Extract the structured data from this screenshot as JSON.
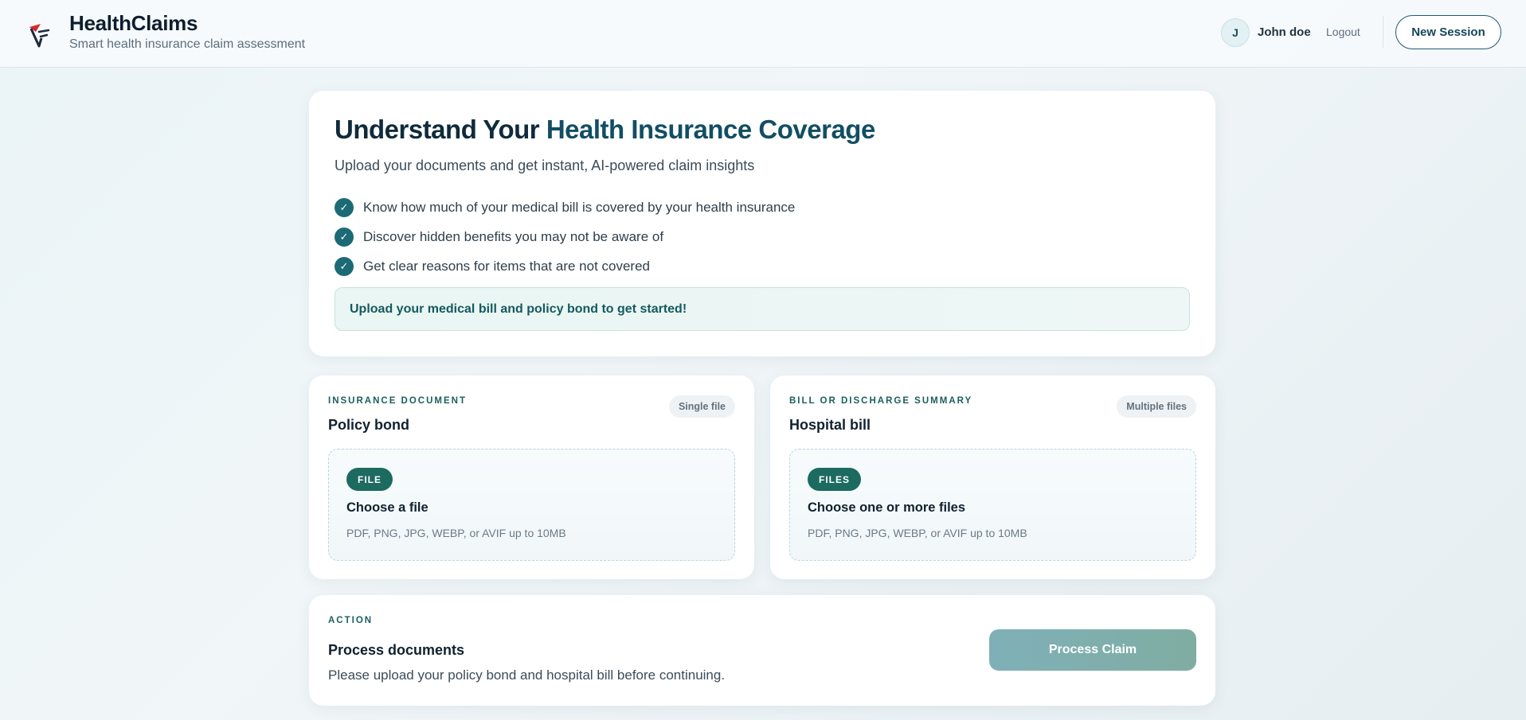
{
  "header": {
    "brand_title": "HealthClaims",
    "brand_subtitle": "Smart health insurance claim assessment",
    "avatar_initial": "J",
    "user_name": "John doe",
    "logout_label": "Logout",
    "new_session_label": "New Session"
  },
  "hero": {
    "title_part1": "Understand Your ",
    "title_part2": "Health Insurance Coverage",
    "subtitle": "Upload your documents and get instant, AI-powered claim insights",
    "bullets": [
      "Know how much of your medical bill is covered by your health insurance",
      "Discover hidden benefits you may not be aware of",
      "Get clear reasons for items that are not covered"
    ],
    "callout": "Upload your medical bill and policy bond to get started!"
  },
  "uploads": [
    {
      "eyebrow": "INSURANCE DOCUMENT",
      "badge": "Single file",
      "title": "Policy bond",
      "pill": "FILE",
      "prompt": "Choose a file",
      "hint": "PDF, PNG, JPG, WEBP, or AVIF up to 10MB"
    },
    {
      "eyebrow": "BILL OR DISCHARGE SUMMARY",
      "badge": "Multiple files",
      "title": "Hospital bill",
      "pill": "FILES",
      "prompt": "Choose one or more files",
      "hint": "PDF, PNG, JPG, WEBP, or AVIF up to 10MB"
    }
  ],
  "action": {
    "eyebrow": "ACTION",
    "title": "Process documents",
    "subtitle": "Please upload your policy bond and hospital bill before continuing.",
    "button_label": "Process Claim"
  },
  "icons": {
    "logo": "brand-logo-icon",
    "check": "check-icon",
    "check_glyph": "✓"
  },
  "colors": {
    "primary": "#1c6a60",
    "accent": "#124e63",
    "button_disabled": "#7fb0b8"
  }
}
